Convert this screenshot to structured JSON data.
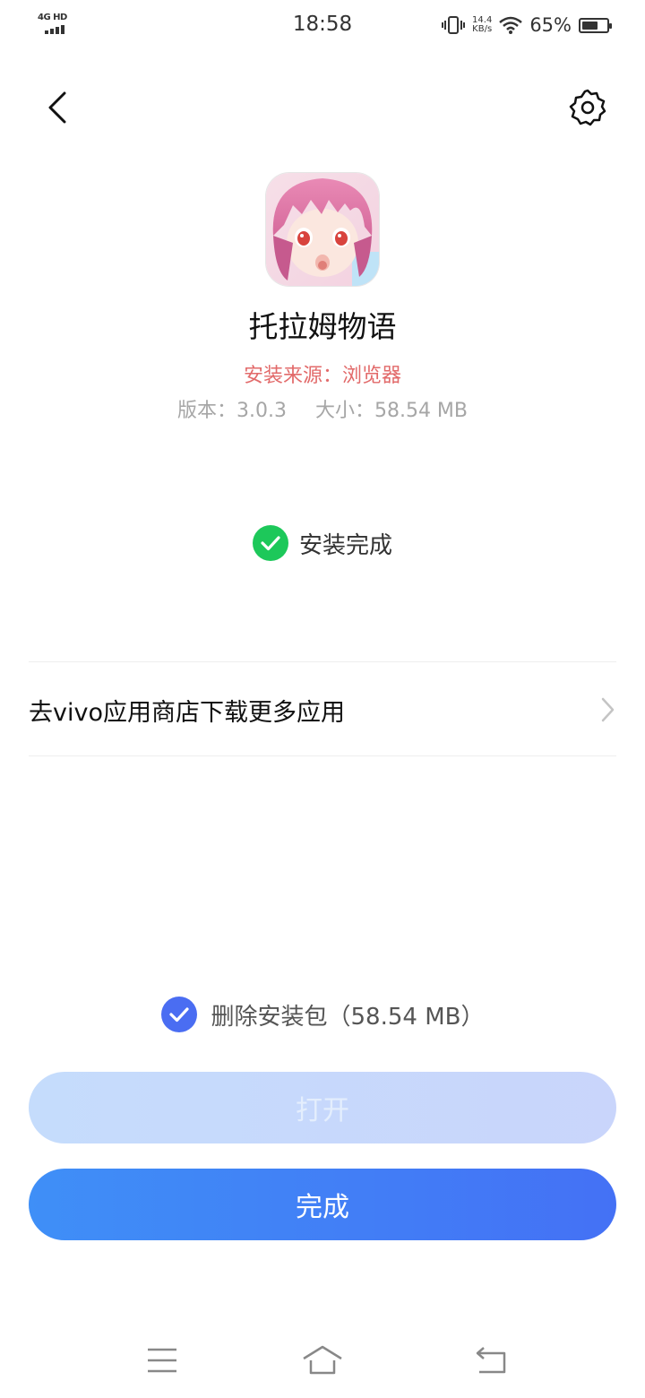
{
  "status_bar": {
    "network": "4G HD",
    "time": "18:58",
    "speed_value": "14.4",
    "speed_unit": "KB/s",
    "battery_percent": "65%",
    "battery_level": 0.65,
    "icons": [
      "signal-icon",
      "vibrate-icon",
      "wifi-icon",
      "battery-icon"
    ]
  },
  "header": {
    "back_icon": "chevron-left-icon",
    "settings_icon": "gear-icon"
  },
  "app": {
    "name": "托拉姆物语",
    "source": "安装来源：浏览器",
    "version_label": "版本：3.0.3",
    "size_label": "大小：58.54 MB"
  },
  "status": {
    "text": "安装完成",
    "icon": "check-circle-icon",
    "color": "#1dc85a"
  },
  "store_link": {
    "label": "去vivo应用商店下载更多应用",
    "icon": "chevron-right-icon"
  },
  "delete_package": {
    "label": "删除安装包（58.54 MB）",
    "checked": true,
    "color": "#4a6df2"
  },
  "buttons": {
    "open": "打开",
    "done": "完成",
    "accent": "#4176f5"
  },
  "nav_bar": {
    "icons": [
      "menu-icon",
      "home-icon",
      "back-icon"
    ]
  }
}
